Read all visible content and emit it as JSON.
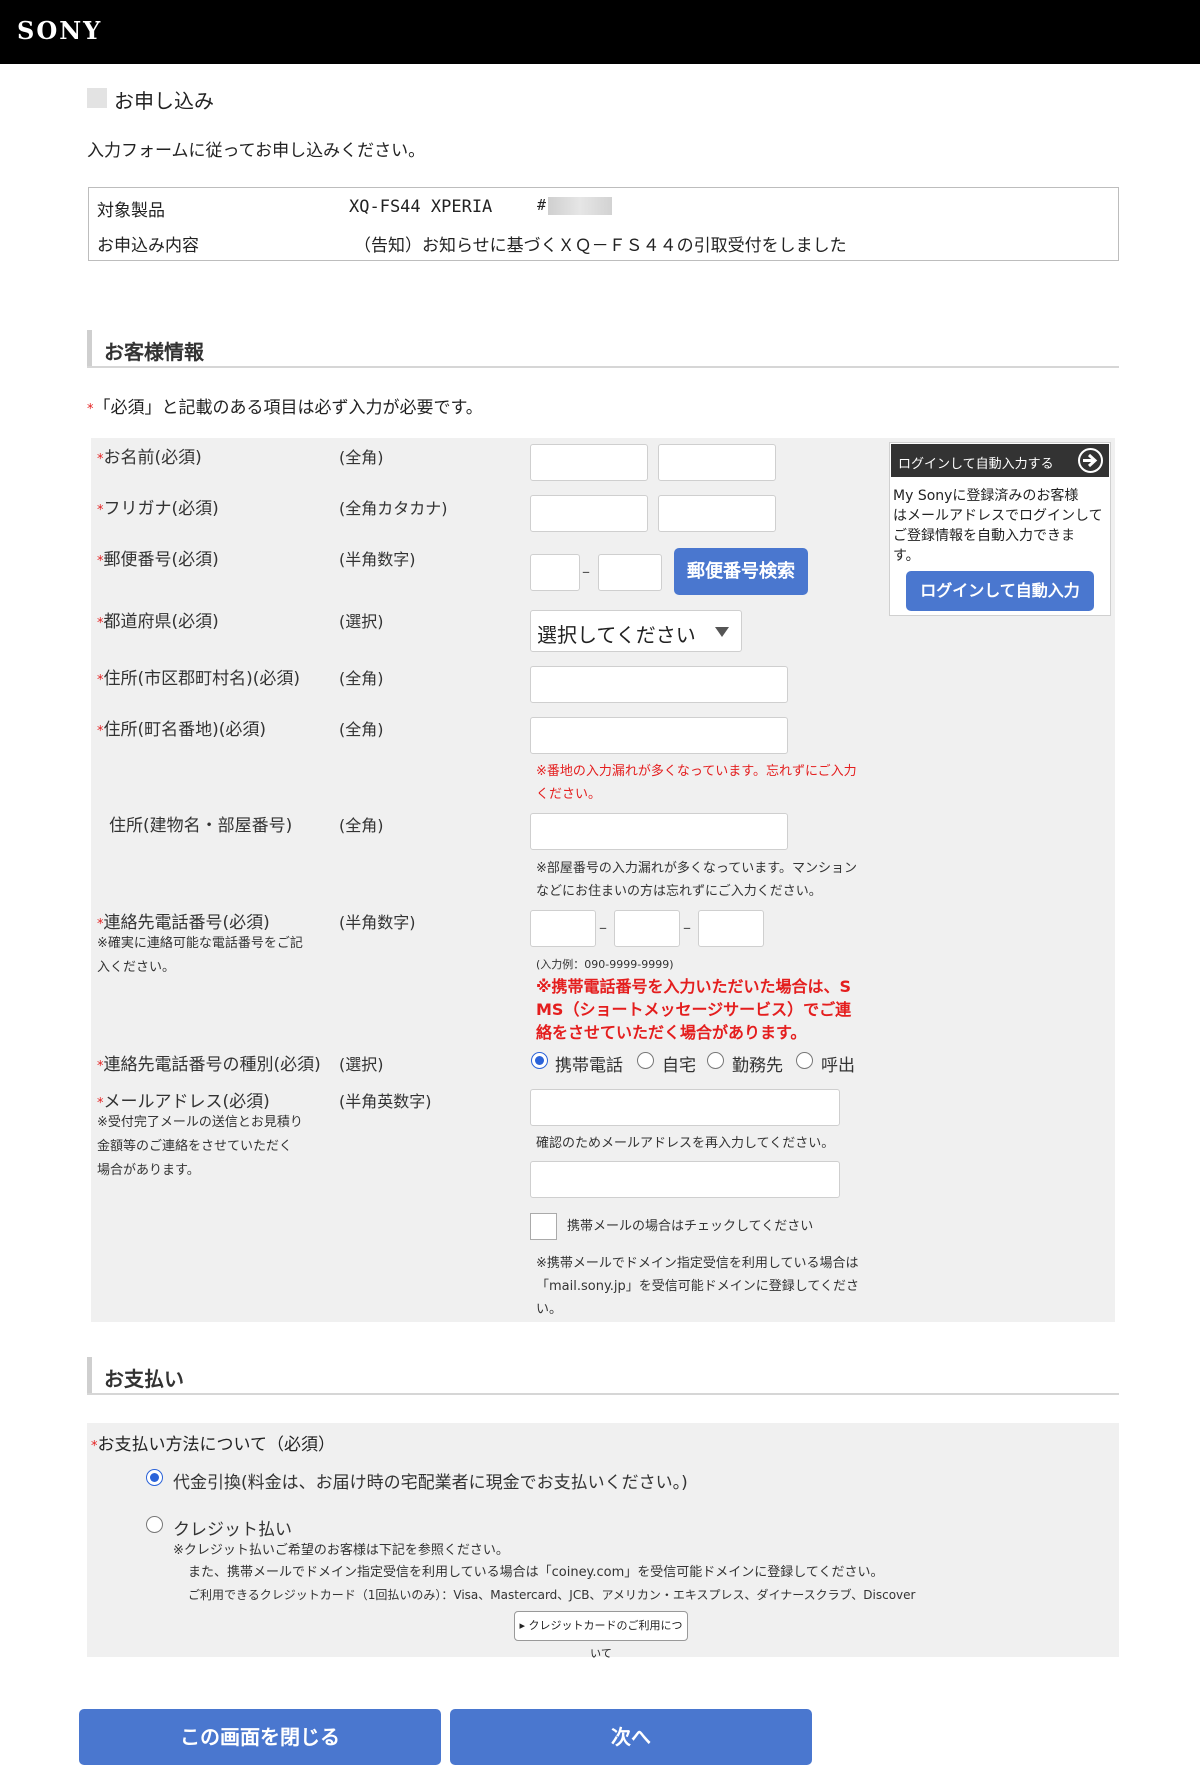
{
  "header": {
    "logo": "SONY"
  },
  "page": {
    "title": "お申し込み",
    "intro": "入力フォームに従ってお申し込みください。"
  },
  "product": {
    "product_label": "対象製品",
    "product_value": "XQ-FS44 XPERIA",
    "product_hash": "#",
    "content_label": "お申込み内容",
    "content_value": "（告知）お知らせに基づくＸＱ－ＦＳ４４の引取受付をしました"
  },
  "customer": {
    "heading": "お客様情報",
    "required_note": "「必須」と記載のある項目は必ず入力が必要です。",
    "star": "*",
    "fields": {
      "name": {
        "label": "お名前(必須)",
        "type": "(全角)"
      },
      "furigana": {
        "label": "フリガナ(必須)",
        "type": "(全角カタカナ)"
      },
      "postal": {
        "label": "郵便番号(必須)",
        "type": "(半角数字)",
        "dash": "–",
        "button": "郵便番号検索"
      },
      "prefecture": {
        "label": "都道府県(必須)",
        "type": "(選択)",
        "selected": "選択してください"
      },
      "city": {
        "label": "住所(市区郡町村名)(必須)",
        "type": "(全角)"
      },
      "street": {
        "label": "住所(町名番地)(必須)",
        "type": "(全角)",
        "note_line1": "※番地の入力漏れが多くなっています。忘れずにご入力",
        "note_line2": "ください。"
      },
      "building": {
        "label": "住所(建物名・部屋番号)",
        "type": "(全角)",
        "note_line1": "※部屋番号の入力漏れが多くなっています。マンション",
        "note_line2": "などにお住まいの方は忘れずにご入力ください。"
      },
      "phone": {
        "label": "連絡先電話番号(必須)",
        "type": "(半角数字)",
        "sub_line1": "※確実に連絡可能な電話番号をご記",
        "sub_line2": "入ください。",
        "dash": "–",
        "example": "(入力例：090-9999-9999)",
        "sms_line1": "※携帯電話番号を入力いただいた場合は、S",
        "sms_line2": "MS（ショートメッセージサービス）でご連",
        "sms_line3": "絡をさせていただく場合があります。"
      },
      "phone_type": {
        "label": "連絡先電話番号の種別(必須)",
        "type": "(選択)",
        "options": [
          "携帯電話",
          "自宅",
          "勤務先",
          "呼出"
        ],
        "selected": "携帯電話"
      },
      "email": {
        "label": "メールアドレス(必須)",
        "type": "(半角英数字)",
        "sub_line1": "※受付完了メールの送信とお見積り",
        "sub_line2": "金額等のご連絡をさせていただく",
        "sub_line3": "場合があります。",
        "confirm_note": "確認のためメールアドレスを再入力してください。",
        "mobile_check": "携帯メールの場合はチェックしてください",
        "domain_line1": "※携帯メールでドメイン指定受信を利用している場合は",
        "domain_line2": "「mail.sony.jp」を受信可能ドメインに登録してくださ",
        "domain_line3": "い。"
      }
    },
    "login": {
      "header": "ログインして自動入力する",
      "desc_line1": "My Sonyに登録済みのお客様",
      "desc_line2": "はメールアドレスでログインして",
      "desc_line3": "ご登録情報を自動入力できま",
      "desc_line4": "す。",
      "button": "ログインして自動入力"
    }
  },
  "payment": {
    "heading": "お支払い",
    "method_label": "お支払い方法について（必須）",
    "cod": "代金引換(料金は、お届け時の宅配業者に現金でお支払いください。)",
    "credit": "クレジット払い",
    "credit_note1": "※クレジット払いご希望のお客様は下記を参照ください。",
    "credit_note2": "また、携帯メールでドメイン指定受信を利用している場合は「coiney.com」を受信可能ドメインに登録してください。",
    "credit_note3": "ご利用できるクレジットカード（1回払いのみ）：Visa、Mastercard、JCB、アメリカン・エキスプレス、ダイナースクラブ、Discover",
    "credit_button": "▸ クレジットカードのご利用について",
    "selected": "代金引換"
  },
  "footer": {
    "close": "この画面を閉じる",
    "next": "次へ"
  },
  "colors": {
    "accent": "#4a77cf",
    "required": "#e41e1e",
    "radio": "#2b63d9"
  }
}
